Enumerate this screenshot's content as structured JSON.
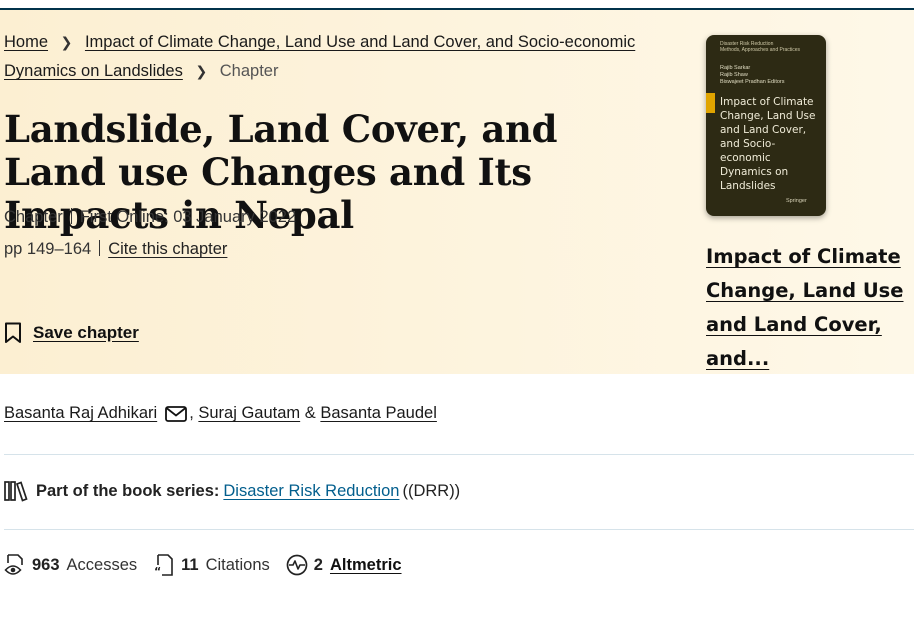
{
  "breadcrumb": {
    "home": "Home",
    "book": "Impact of Climate Change, Land Use and Land Cover, and Socio-economic Dynamics on Landslides",
    "current": "Chapter"
  },
  "chapter": {
    "title": "Landslide, Land Cover, and Land use Changes and Its Impacts in Nepal",
    "type": "Chapter",
    "first_online": "First Online: 03 January 2022",
    "pages": "pp 149–164",
    "cite_label": "Cite this chapter",
    "save_label": "Save chapter"
  },
  "book": {
    "cover_series": "Disaster Risk Reduction\nMethods, Approaches and Practices",
    "cover_editors": "Rajib Sarkar\nRajib Shaw\nBiswajeet Pradhan  Editors",
    "cover_title": "Impact of Climate Change, Land Use and Land Cover, and Socio-economic Dynamics on Landslides",
    "cover_publisher": "Springer",
    "link_label": "Impact of Climate Change, Land Use and Land Cover, and..."
  },
  "authors": [
    {
      "name": "Basanta Raj Adhikari"
    },
    {
      "name": "Suraj Gautam"
    },
    {
      "name": "Basanta Paudel"
    }
  ],
  "author_sep": {
    "comma": ",",
    "amp": "&"
  },
  "series": {
    "label": "Part of the book series:",
    "name": "Disaster Risk Reduction",
    "abbr": "((DRR))"
  },
  "metrics": {
    "accesses_count": "963",
    "accesses_label": "Accesses",
    "citations_count": "11",
    "citations_label": "Citations",
    "altmetric_count": "2",
    "altmetric_label": "Altmetric"
  },
  "colors": {
    "hero_bg": "#fdf3dc",
    "link_blue": "#025e8d",
    "top_border": "#01324b",
    "cover_bg": "#2d2a14",
    "cover_accent": "#e0a400"
  },
  "icons": [
    "chevron-right-icon",
    "bookmark-icon",
    "envelope-icon",
    "books-icon",
    "eye-icon",
    "citation-icon",
    "altmetric-icon"
  ]
}
